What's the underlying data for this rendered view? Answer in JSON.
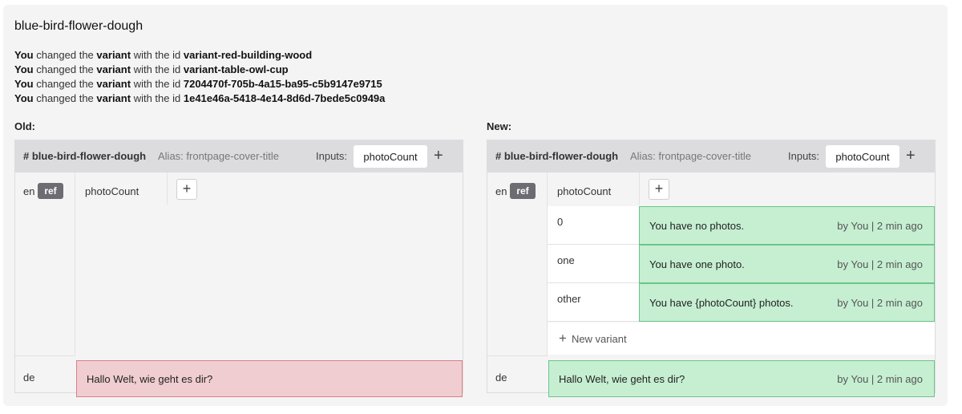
{
  "key": "blue-bird-flower-dough",
  "changes": [
    {
      "actor": "You",
      "verb": "changed the",
      "entity": "variant",
      "mid": "with the id",
      "id": "variant-red-building-wood"
    },
    {
      "actor": "You",
      "verb": "changed the",
      "entity": "variant",
      "mid": "with the id",
      "id": "variant-table-owl-cup"
    },
    {
      "actor": "You",
      "verb": "changed the",
      "entity": "variant",
      "mid": "with the id",
      "id": "7204470f-705b-4a15-ba95-c5b9147e9715"
    },
    {
      "actor": "You",
      "verb": "changed the",
      "entity": "variant",
      "mid": "with the id",
      "id": "1e41e46a-5418-4e14-8d6d-7bede5c0949a"
    }
  ],
  "old": {
    "label": "Old:",
    "key": "# blue-bird-flower-dough",
    "alias": "Alias: frontpage-cover-title",
    "inputs_label": "Inputs:",
    "input": "photoCount",
    "ref_lang": "en",
    "ref_badge": "ref",
    "variant_header": "photoCount",
    "de_lang": "de",
    "de_value": "Hallo Welt, wie geht es dir?"
  },
  "new": {
    "label": "New:",
    "key": "# blue-bird-flower-dough",
    "alias": "Alias: frontpage-cover-title",
    "inputs_label": "Inputs:",
    "input": "photoCount",
    "ref_lang": "en",
    "ref_badge": "ref",
    "variant_header": "photoCount",
    "variants": [
      {
        "match": "0",
        "value": "You have no photos.",
        "meta": "by You | 2 min ago"
      },
      {
        "match": "one",
        "value": "You have one photo.",
        "meta": "by You | 2 min ago"
      },
      {
        "match": "other",
        "value": "You have {photoCount} photos.",
        "meta": "by You | 2 min ago"
      }
    ],
    "new_variant": "New variant",
    "de_lang": "de",
    "de_value": "Hallo Welt, wie geht es dir?",
    "de_meta": "by You | 2 min ago"
  },
  "icons": {
    "plus": "+"
  },
  "colors": {
    "added": "#c6efd2",
    "removed": "#f0cdd0",
    "header": "#dcdcdf"
  }
}
